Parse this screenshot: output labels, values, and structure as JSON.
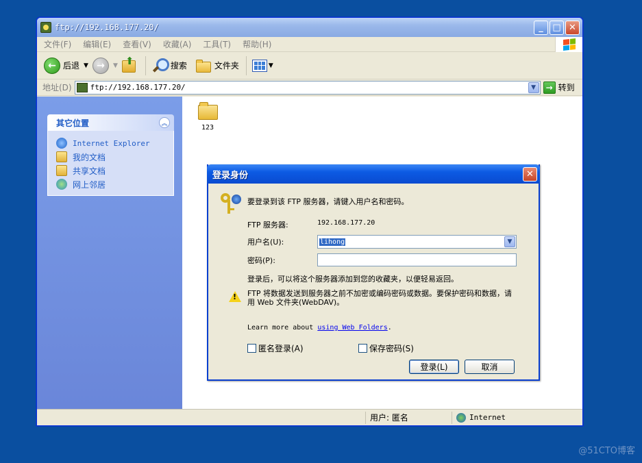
{
  "window": {
    "title": "ftp://192.168.177.20/",
    "controls": {
      "minimize": "_",
      "maximize": "□",
      "close": "✕"
    }
  },
  "menu": [
    "文件(F)",
    "编辑(E)",
    "查看(V)",
    "收藏(A)",
    "工具(T)",
    "帮助(H)"
  ],
  "toolbar": {
    "back_label": "后退",
    "search_label": "搜索",
    "folders_label": "文件夹"
  },
  "address": {
    "label": "地址(D)",
    "value": "ftp://192.168.177.20/",
    "go_label": "转到"
  },
  "taskpane": {
    "header": "其它位置",
    "links": [
      "Internet Explorer",
      "我的文档",
      "共享文档",
      "网上邻居"
    ]
  },
  "files": [
    {
      "name": "123",
      "icon": "folder-icon"
    }
  ],
  "status": {
    "user": "用户: 匿名",
    "zone": "Internet"
  },
  "dialog": {
    "title": "登录身份",
    "intro": "要登录到该 FTP 服务器，请键入用户名和密码。",
    "server_label": "FTP 服务器:",
    "server_value": "192.168.177.20",
    "username_label": "用户名(U):",
    "username_value": "lihong",
    "password_label": "密码(P):",
    "password_value": "",
    "after_login_note": "登录后，可以将这个服务器添加到您的收藏夹，以便轻易返回。",
    "warning": "FTP 将数据发送到服务器之前不加密或编码密码或数据。要保护密码和数据，请用 Web 文件夹(WebDAV)。",
    "learn_more_prefix": "Learn more about ",
    "learn_more_link": "using Web Folders",
    "learn_more_suffix": ".",
    "anonymous_label": "匿名登录(A)",
    "save_password_label": "保存密码(S)",
    "login_button": "登录(L)",
    "cancel_button": "取消"
  },
  "watermark": "@51CTO博客",
  "colors": {
    "desktop": "#0a4fa0",
    "dialog_title": "#0c5ae3",
    "taskpane": "#7b9de8",
    "link": "#215dc6"
  }
}
